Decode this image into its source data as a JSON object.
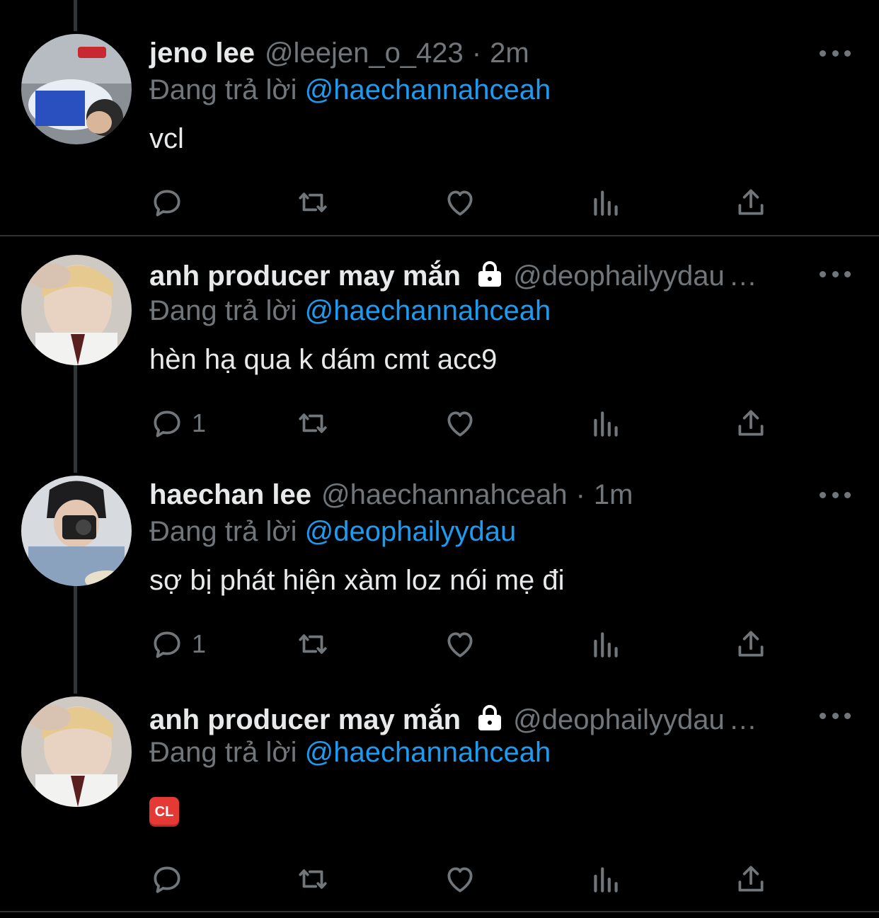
{
  "tweets": [
    {
      "name": "jeno lee",
      "handle": "@leejen_o_423",
      "dot": "·",
      "time": "2m",
      "locked": false,
      "reply_prefix": "Đang trả lời",
      "reply_to": "@haechannahceah",
      "text": "vcl",
      "reply_count": "",
      "avatar_icon": "user-avatar-photo"
    },
    {
      "name": "anh producer may mắn",
      "handle": "@deophailyydau",
      "time": "",
      "locked": true,
      "reply_prefix": "Đang trả lời",
      "reply_to": "@haechannahceah",
      "text": "hèn hạ qua k dám cmt acc9",
      "reply_count": "1",
      "avatar_icon": "user-avatar-photo"
    },
    {
      "name": "haechan lee",
      "handle": "@haechannahceah",
      "dot": "·",
      "time": "1m",
      "locked": false,
      "reply_prefix": "Đang trả lời",
      "reply_to": "@deophailyydau",
      "text": "sợ bị phát hiện xàm loz nói mẹ đi",
      "reply_count": "1",
      "avatar_icon": "user-avatar-photo"
    },
    {
      "name": "anh producer may mắn",
      "handle": "@deophailyydau",
      "time": "",
      "locked": true,
      "reply_prefix": "Đang trả lời",
      "reply_to": "@haechannahceah",
      "text": "",
      "emoji_badge": "CL",
      "reply_count": "",
      "avatar_icon": "user-avatar-photo"
    }
  ],
  "icons": {
    "reply": "reply-icon",
    "retweet": "retweet-icon",
    "like": "heart-icon",
    "views": "analytics-icon",
    "share": "share-icon",
    "more": "more-icon",
    "lock": "lock-icon"
  },
  "colors": {
    "background": "#000000",
    "text": "#e7e9ea",
    "muted": "#71767b",
    "link": "#1d9bf0",
    "divider": "#2f3336",
    "badge": "#e53935"
  }
}
